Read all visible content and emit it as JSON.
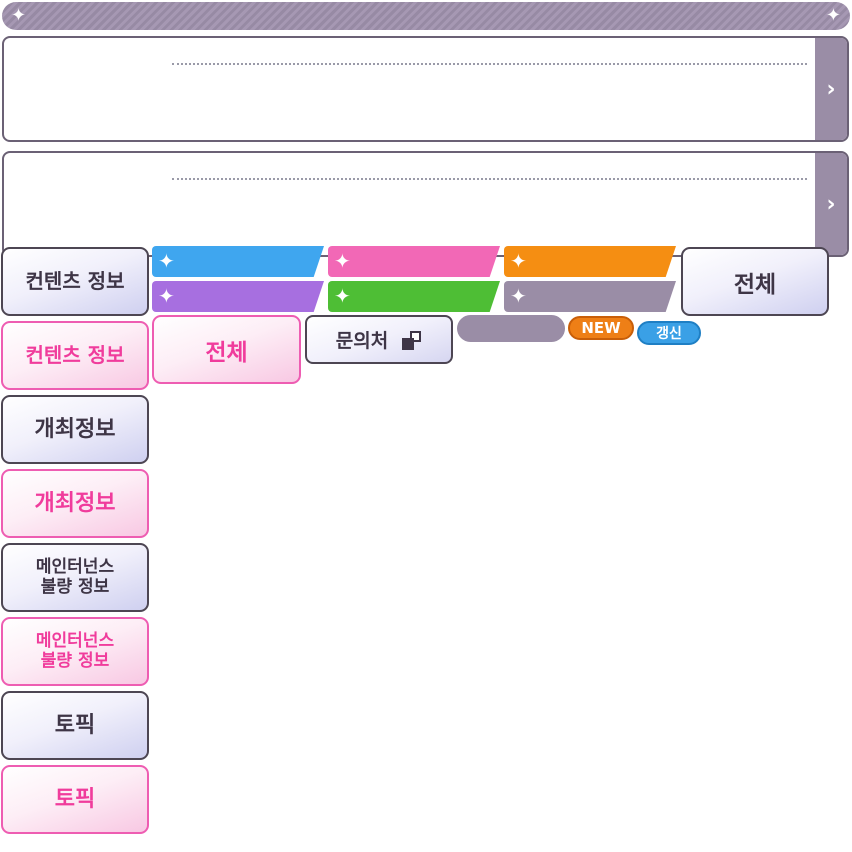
{
  "header": {
    "left_icon": "sparkle-icon",
    "right_icon": "sparkle-icon"
  },
  "news_panels": [
    {
      "arrow_icon": "chevron-right-icon"
    },
    {
      "arrow_icon": "chevron-right-icon"
    }
  ],
  "side_buttons": [
    {
      "label": "컨텐츠 정보",
      "state": "normal"
    },
    {
      "label": "컨텐츠 정보",
      "state": "selected"
    },
    {
      "label": "개최정보",
      "state": "normal"
    },
    {
      "label": "개최정보",
      "state": "selected"
    },
    {
      "label": "메인터넌스\n불량 정보",
      "state": "normal"
    },
    {
      "label": "메인터넌스\n불량 정보",
      "state": "selected"
    },
    {
      "label": "토픽",
      "state": "normal"
    },
    {
      "label": "토픽",
      "state": "selected"
    }
  ],
  "category_tabs": [
    {
      "color": "#3fa6ef",
      "icon": "sparkle-icon"
    },
    {
      "color": "#f268b6",
      "icon": "sparkle-icon"
    },
    {
      "color": "#f58e12",
      "icon": "sparkle-icon"
    },
    {
      "color": "#a76fe0",
      "icon": "sparkle-icon"
    },
    {
      "color": "#4ebe35",
      "icon": "sparkle-icon"
    },
    {
      "color": "#9a8da6",
      "icon": "sparkle-icon"
    }
  ],
  "all_buttons": {
    "normal": "전체",
    "selected": "전체"
  },
  "contact": {
    "label": "문의처",
    "icon": "external-link-icon"
  },
  "badges": {
    "new": "NEW",
    "update": "갱신"
  },
  "colors": {
    "accent_pink": "#ee5db2",
    "frame_gray": "#4d4653",
    "header_purple": "#978aa4"
  }
}
